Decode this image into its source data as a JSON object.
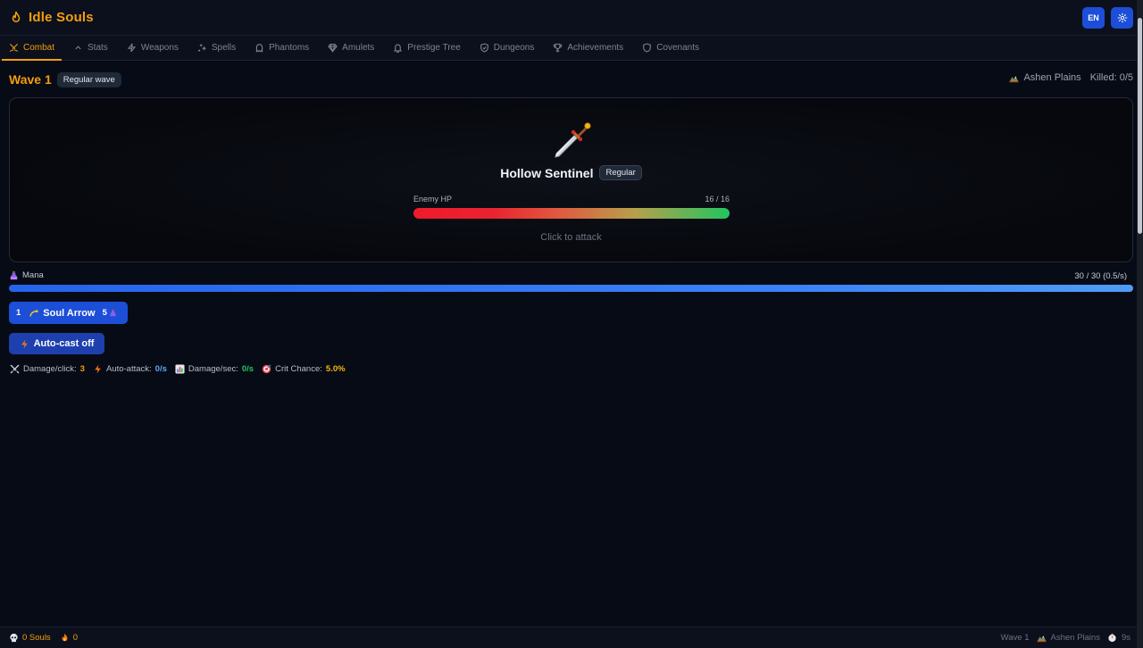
{
  "app": {
    "title": "Idle Souls"
  },
  "header": {
    "language_label": "EN",
    "settings_icon": "gear-icon"
  },
  "nav": {
    "tabs": [
      {
        "label": "Combat",
        "icon": "crossed-swords-icon",
        "active": true
      },
      {
        "label": "Stats",
        "icon": "chevron-up-icon"
      },
      {
        "label": "Weapons",
        "icon": "lightning-icon"
      },
      {
        "label": "Spells",
        "icon": "sparkles-icon"
      },
      {
        "label": "Phantoms",
        "icon": "ghost-icon"
      },
      {
        "label": "Amulets",
        "icon": "gem-icon"
      },
      {
        "label": "Prestige Tree",
        "icon": "bell-icon"
      },
      {
        "label": "Dungeons",
        "icon": "shield-icon"
      },
      {
        "label": "Achievements",
        "icon": "trophy-icon"
      },
      {
        "label": "Covenants",
        "icon": "shield-outline-icon"
      }
    ]
  },
  "wave": {
    "title": "Wave 1",
    "badge": "Regular wave",
    "location": "Ashen Plains",
    "killed": "Killed: 0/5"
  },
  "enemy": {
    "name": "Hollow Sentinel",
    "rank": "Regular",
    "hp_label": "Enemy HP",
    "hp_text": "16 / 16",
    "hp_fraction": 1.0,
    "hint": "Click to attack"
  },
  "mana": {
    "label": "Mana",
    "value_text": "30 / 30 (0.5/s)",
    "fraction": 1.0
  },
  "spell": {
    "key": "1",
    "name": "Soul Arrow",
    "cost": "5"
  },
  "autocast": {
    "label": "Auto-cast off"
  },
  "stats": {
    "damage_click_label": "Damage/click:",
    "damage_click_value": "3",
    "auto_attack_label": "Auto-attack:",
    "auto_attack_value": "0/s",
    "dps_label": "Damage/sec:",
    "dps_value": "0/s",
    "crit_label": "Crit Chance:",
    "crit_value": "5.0%"
  },
  "footer": {
    "souls": "0 Souls",
    "embers": "0",
    "wave": "Wave 1",
    "location": "Ashen Plains",
    "time": "9s"
  },
  "colors": {
    "accent": "#f59e0b",
    "primary_button": "#1d4ed8",
    "mana": "#3b82f6",
    "hp_start": "#ef1a2c",
    "hp_end": "#22c55e"
  }
}
